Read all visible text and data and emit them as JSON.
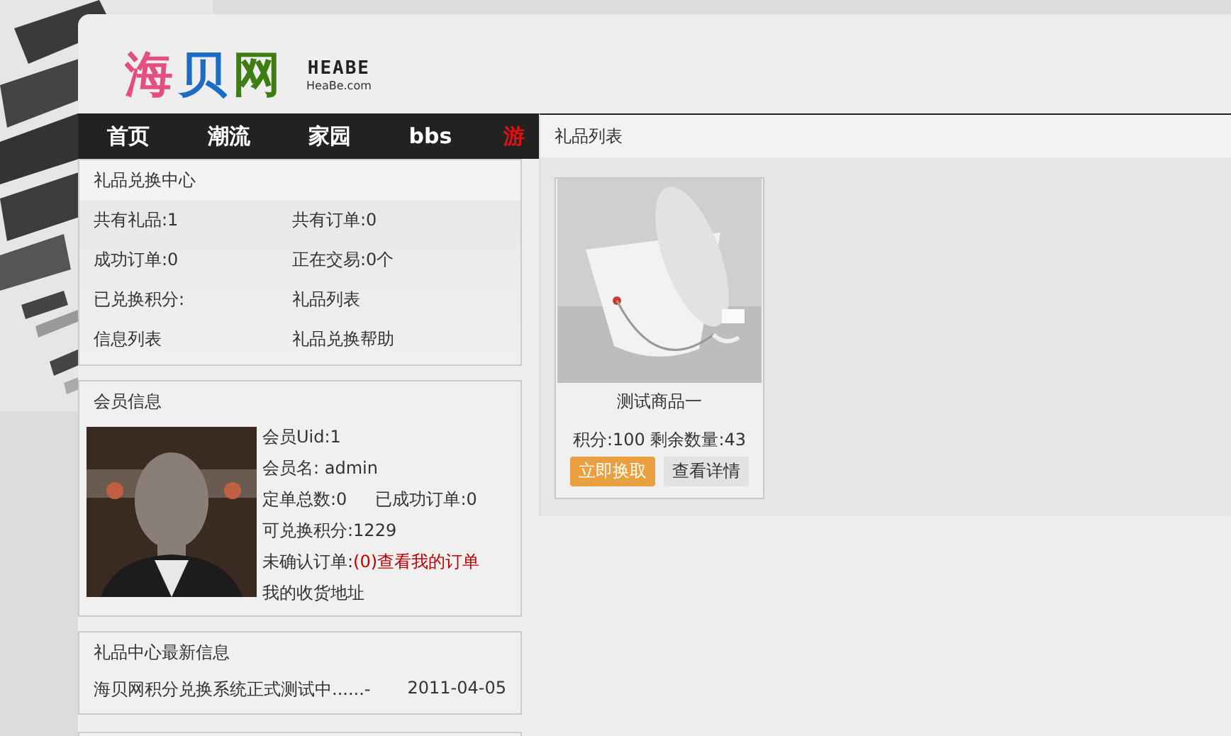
{
  "logo": {
    "text": "海贝网",
    "mark": "HEABE",
    "domain": "HeaBe.com"
  },
  "nav": [
    {
      "label": "首页",
      "selected": false
    },
    {
      "label": "潮流",
      "selected": false
    },
    {
      "label": "家园",
      "selected": false
    },
    {
      "label": "bbs",
      "selected": false
    },
    {
      "label": "游",
      "selected": true
    }
  ],
  "center": {
    "title": "礼品兑换中心",
    "cells": [
      "共有礼品:1",
      "共有订单:0",
      "成功订单:0",
      "正在交易:0个",
      "已兑换积分:",
      "礼品列表",
      "信息列表",
      "礼品兑换帮助"
    ]
  },
  "member": {
    "title": "会员信息",
    "uid": "会员Uid:1",
    "name": "会员名: admin",
    "orders": "定单总数:0",
    "success": "已成功订单:0",
    "points": "可兑换积分:1229",
    "unconfirmed_label": "未确认订单:",
    "unconfirmed_count": "(0)",
    "my_orders_link": "查看我的订单",
    "address_link": "我的收货地址"
  },
  "news": {
    "title": "礼品中心最新信息",
    "items": [
      {
        "text": "海贝网积分兑换系统正式测试中......-",
        "date": "2011-04-05"
      }
    ]
  },
  "gift_list": {
    "title": "礼品列表",
    "items": [
      {
        "name": "测试商品一",
        "info": "积分:100 剩余数量:43",
        "buttons": [
          "立即换取",
          "查看详情"
        ]
      }
    ]
  }
}
